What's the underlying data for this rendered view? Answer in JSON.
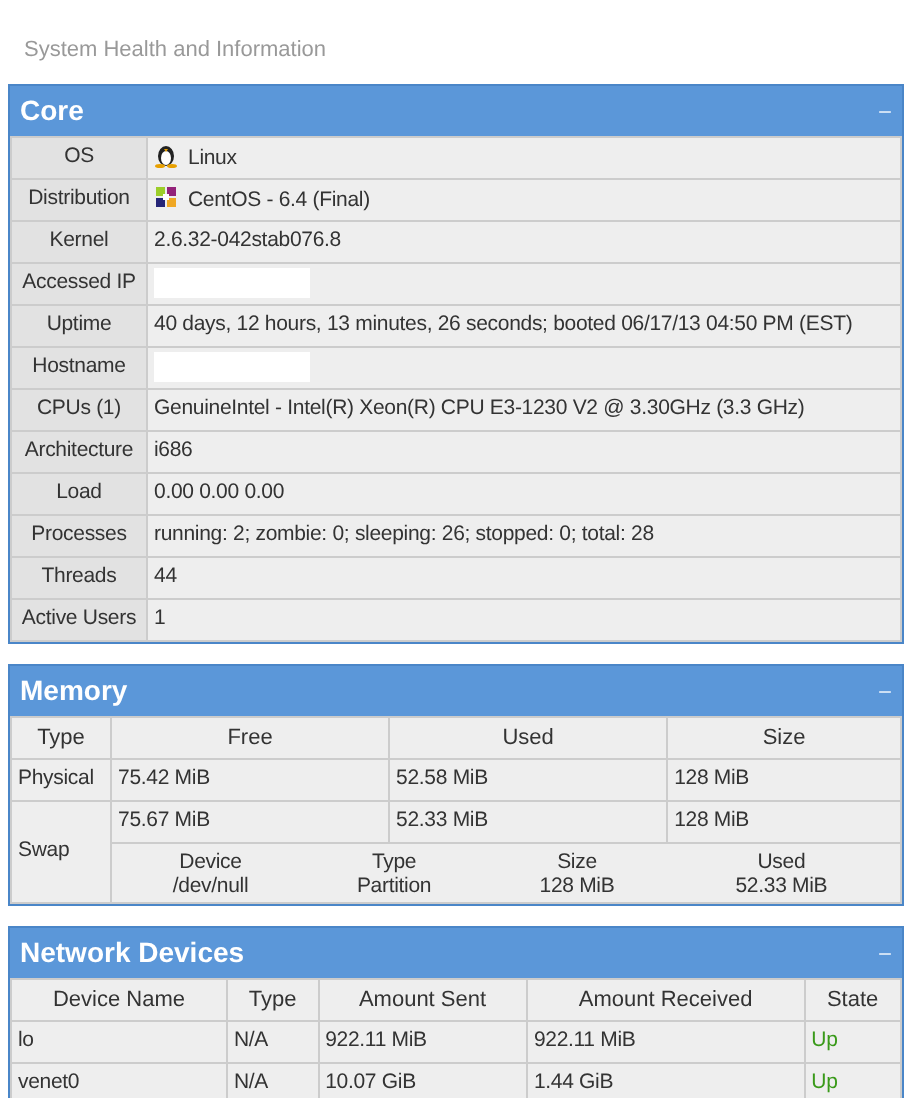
{
  "page_title": "System Health and Information",
  "core": {
    "title": "Core",
    "collapse": "−",
    "rows": [
      {
        "label": "OS",
        "value": "Linux",
        "kind": "os"
      },
      {
        "label": "Distribution",
        "value": "CentOS - 6.4 (Final)",
        "kind": "distro"
      },
      {
        "label": "Kernel",
        "value": "2.6.32-042stab076.8",
        "kind": "text"
      },
      {
        "label": "Accessed IP",
        "kind": "redacted"
      },
      {
        "label": "Uptime",
        "value": "40 days, 12 hours, 13 minutes, 26 seconds; booted 06/17/13 04:50 PM (EST)",
        "kind": "text"
      },
      {
        "label": "Hostname",
        "kind": "redacted"
      },
      {
        "label": "CPUs (1)",
        "value": "GenuineIntel - Intel(R) Xeon(R) CPU E3-1230 V2 @ 3.30GHz (3.3 GHz)",
        "kind": "text"
      },
      {
        "label": "Architecture",
        "value": "i686",
        "kind": "text"
      },
      {
        "label": "Load",
        "value": "0.00 0.00 0.00",
        "kind": "text"
      },
      {
        "label": "Processes",
        "value": "running: 2; zombie: 0; sleeping: 26; stopped: 0; total: 28",
        "kind": "text"
      },
      {
        "label": "Threads",
        "value": "44",
        "kind": "text"
      },
      {
        "label": "Active Users",
        "value": "1",
        "kind": "text"
      }
    ]
  },
  "memory": {
    "title": "Memory",
    "collapse": "−",
    "columns": [
      "Type",
      "Free",
      "Used",
      "Size"
    ],
    "physical": {
      "type": "Physical",
      "free": "75.42 MiB",
      "used": "52.58 MiB",
      "size": "128 MiB"
    },
    "swap": {
      "type": "Swap",
      "free": "75.67 MiB",
      "used": "52.33 MiB",
      "size": "128 MiB",
      "devices_columns": [
        "Device",
        "Type",
        "Size",
        "Used"
      ],
      "devices": [
        [
          "/dev/null",
          "Partition",
          "128 MiB",
          "52.33 MiB"
        ]
      ]
    }
  },
  "network": {
    "title": "Network Devices",
    "collapse": "−",
    "columns": [
      "Device Name",
      "Type",
      "Amount Sent",
      "Amount Received",
      "State"
    ],
    "rows": [
      {
        "name": "lo",
        "type": "N/A",
        "sent": "922.11 MiB",
        "received": "922.11 MiB",
        "state": "Up",
        "up": true
      },
      {
        "name": "venet0",
        "type": "N/A",
        "sent": "10.07 GiB",
        "received": "1.44 GiB",
        "state": "Up",
        "up": true
      }
    ]
  }
}
